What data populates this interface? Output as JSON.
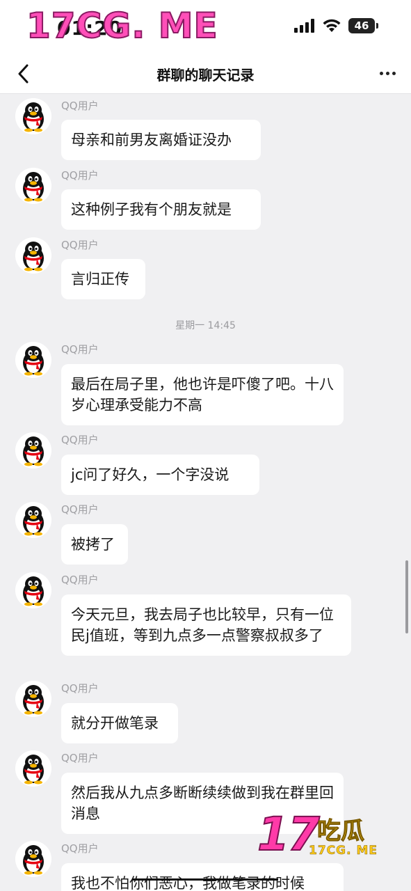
{
  "status_bar": {
    "time": "01:20",
    "battery": "46"
  },
  "watermark_top": "17CG. ME",
  "nav": {
    "title": "群聊的聊天记录"
  },
  "messages": [
    {
      "sender": "QQ用户",
      "text": "母亲和前男友离婚证没办"
    },
    {
      "sender": "QQ用户",
      "text": "这种例子我有个朋友就是"
    },
    {
      "sender": "QQ用户",
      "text": "言归正传"
    },
    {
      "sender": "QQ用户",
      "text": "最后在局子里，他也许是吓傻了吧。十八岁心理承受能力不高"
    },
    {
      "sender": "QQ用户",
      "text": "jc问了好久，一个字没说"
    },
    {
      "sender": "QQ用户",
      "text": "被拷了"
    },
    {
      "sender": "QQ用户",
      "text": "今天元旦，我去局子也比较早，只有一位民j值班，等到九点多一点警察叔叔多了"
    },
    {
      "sender": "QQ用户",
      "text": "就分开做笔录"
    },
    {
      "sender": "QQ用户",
      "text": "然后我从九点多断断续续做到我在群里回消息"
    },
    {
      "sender": "QQ用户",
      "text": "我也不怕你们恶心，我做笔录的时候"
    }
  ],
  "time_divider": "星期一 14:45",
  "watermark_bottom": {
    "big": "17",
    "cn": "吃瓜",
    "url": "17CG. ME"
  },
  "icons": {
    "back": "chevron-left-icon",
    "more": "more-dots-icon",
    "avatar": "qq-penguin-avatar",
    "signal": "cellular-signal-icon",
    "wifi": "wifi-icon",
    "battery": "battery-icon"
  }
}
